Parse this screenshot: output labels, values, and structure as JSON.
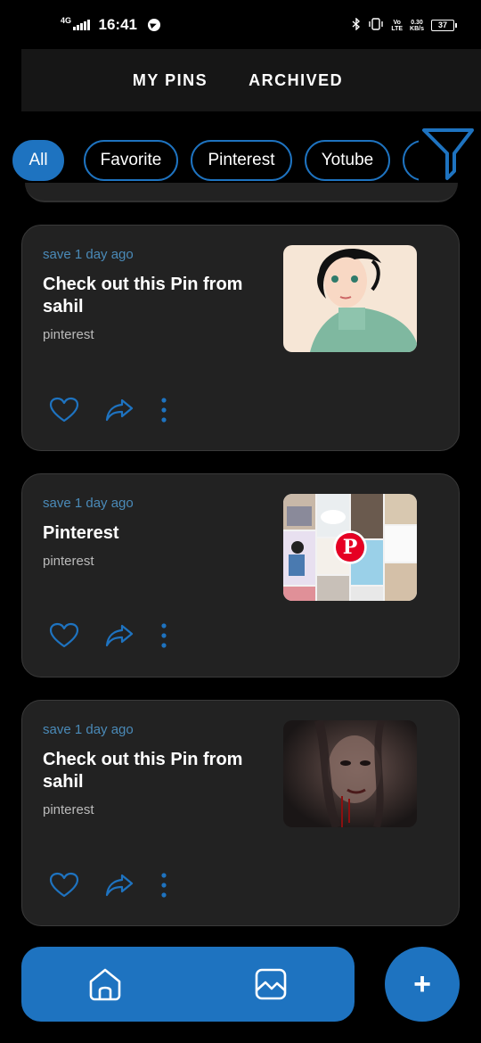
{
  "status_bar": {
    "network": "4G",
    "time": "16:41",
    "volte_line1": "Vo",
    "volte_line2": "LTE",
    "speed_value": "0.30",
    "speed_unit": "KB/s",
    "battery": "37"
  },
  "tabs": [
    {
      "label": "MY PINS"
    },
    {
      "label": "ARCHIVED"
    }
  ],
  "filters": [
    {
      "label": "All",
      "active": true
    },
    {
      "label": "Favorite",
      "active": false
    },
    {
      "label": "Pinterest",
      "active": false
    },
    {
      "label": "Yotube",
      "active": false
    }
  ],
  "pins": [
    {
      "time": "save 1 day ago",
      "title": "Check out this Pin from sahil",
      "source": "pinterest",
      "thumb": "anime-girl-illustration"
    },
    {
      "time": "save 1 day ago",
      "title": "Pinterest",
      "source": "pinterest",
      "thumb": "pinterest-collage"
    },
    {
      "time": "save 1 day ago",
      "title": "Check out this Pin from sahil",
      "source": "pinterest",
      "thumb": "dark-portrait"
    }
  ],
  "fab": {
    "label": "+"
  },
  "colors": {
    "accent": "#1e73c0",
    "card": "#222222",
    "background": "#000000",
    "muted": "#4a8ab8"
  },
  "icons": [
    "heart-icon",
    "share-icon",
    "more-vertical-icon",
    "home-icon",
    "gallery-icon",
    "filter-icon"
  ]
}
